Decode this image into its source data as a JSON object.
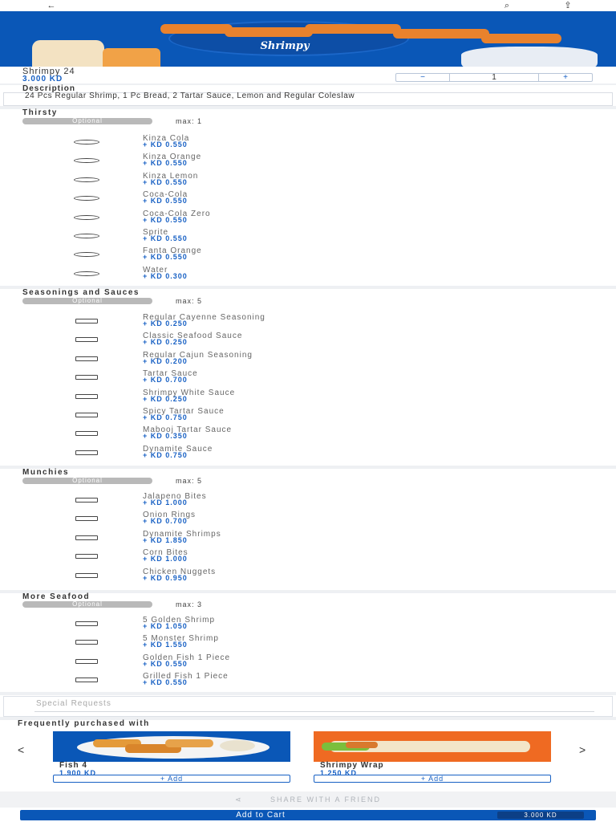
{
  "header": {
    "back_icon": "←",
    "search_icon": "⌕",
    "share_icon": "⇪"
  },
  "banner": {
    "logo_text": "Shrimpy"
  },
  "product": {
    "name": "Shrimpy 24",
    "price": "3.000 KD",
    "quantity": "1",
    "minus": "−",
    "plus": "+"
  },
  "description": {
    "title": "Description",
    "text": "24 Pcs Regular Shrimp, 1 Pc Bread, 2 Tartar Sauce, Lemon and Regular Coleslaw"
  },
  "sections": [
    {
      "title": "Thirsty",
      "tag": "Optional",
      "max": "max: 1",
      "type": "radio",
      "options": [
        {
          "name": "Kinza Cola",
          "price": "+ KD 0.550"
        },
        {
          "name": "Kinza Orange",
          "price": "+ KD 0.550"
        },
        {
          "name": "Kinza Lemon",
          "price": "+ KD 0.550"
        },
        {
          "name": "Coca-Cola",
          "price": "+ KD 0.550"
        },
        {
          "name": "Coca-Cola Zero",
          "price": "+ KD 0.550"
        },
        {
          "name": "Sprite",
          "price": "+ KD 0.550"
        },
        {
          "name": "Fanta Orange",
          "price": "+ KD 0.550"
        },
        {
          "name": "Water",
          "price": "+ KD 0.300"
        }
      ]
    },
    {
      "title": "Seasonings and Sauces",
      "tag": "Optional",
      "max": "max: 5",
      "type": "check",
      "options": [
        {
          "name": "Regular Cayenne Seasoning",
          "price": "+ KD 0.250"
        },
        {
          "name": "Classic Seafood Sauce",
          "price": "+ KD 0.250"
        },
        {
          "name": "Regular Cajun Seasoning",
          "price": "+ KD 0.200"
        },
        {
          "name": "Tartar Sauce",
          "price": "+ KD 0.700"
        },
        {
          "name": "Shrimpy White  Sauce",
          "price": "+ KD 0.250"
        },
        {
          "name": "Spicy Tartar Sauce",
          "price": "+ KD 0.750"
        },
        {
          "name": "Mabooj Tartar Sauce",
          "price": "+ KD 0.350"
        },
        {
          "name": "Dynamite Sauce",
          "price": "+ KD 0.750"
        }
      ]
    },
    {
      "title": "Munchies",
      "tag": "Optional",
      "max": "max: 5",
      "type": "check",
      "options": [
        {
          "name": "Jalapeno Bites",
          "price": "+ KD 1.000"
        },
        {
          "name": "Onion Rings",
          "price": "+ KD 0.700"
        },
        {
          "name": "Dynamite Shrimps",
          "price": "+ KD 1.850"
        },
        {
          "name": "Corn Bites",
          "price": "+ KD 1.000"
        },
        {
          "name": "Chicken Nuggets",
          "price": "+ KD 0.950"
        }
      ]
    },
    {
      "title": "More Seafood",
      "tag": "Optional",
      "max": "max: 3",
      "type": "check",
      "options": [
        {
          "name": "5 Golden Shrimp",
          "price": "+ KD 1.050"
        },
        {
          "name": "5 Monster Shrimp",
          "price": "+ KD 1.550"
        },
        {
          "name": "Golden Fish 1 Piece",
          "price": "+ KD 0.550"
        },
        {
          "name": "Grilled Fish 1 Piece",
          "price": "+ KD 0.550"
        }
      ]
    }
  ],
  "special": {
    "placeholder": "Special Requests"
  },
  "frequently": {
    "title": "Frequently purchased with",
    "prev": "<",
    "next": ">",
    "items": [
      {
        "name": "Fish 4",
        "price": "1.900 KD",
        "add": "+  Add"
      },
      {
        "name": "Shrimpy Wrap",
        "price": "1.250 KD",
        "add": "+  Add"
      }
    ]
  },
  "share": {
    "label": "SHARE WITH A FRIEND",
    "icon": "⋖"
  },
  "cart": {
    "label": "Add to Cart",
    "total": "3.000 KD"
  },
  "colors": {
    "brand": "#0a57b7",
    "accent": "#1760c4",
    "pill": "#b9b9b9"
  }
}
